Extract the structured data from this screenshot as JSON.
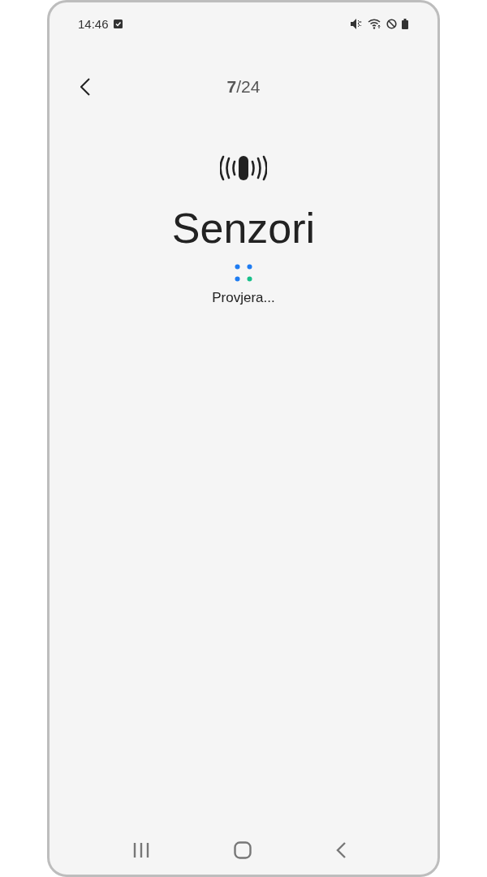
{
  "status_bar": {
    "time": "14:46"
  },
  "header": {
    "progress": "**7**/24"
  },
  "test": {
    "title": "Senzori",
    "status": "Provjera..."
  }
}
